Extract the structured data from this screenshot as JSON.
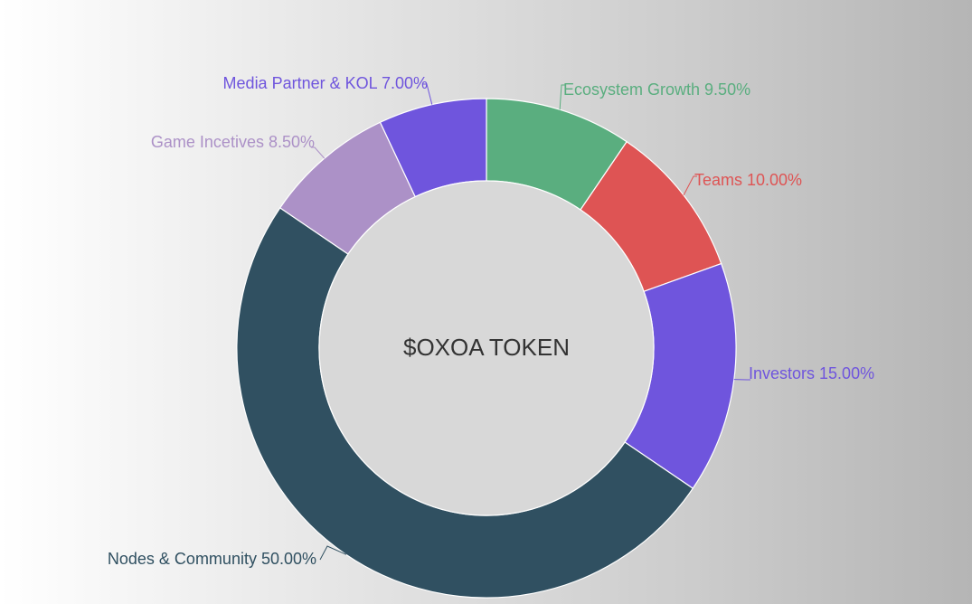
{
  "chart_data": {
    "type": "pie",
    "variant": "donut",
    "center_label": "$OXOA TOKEN",
    "legend": "none",
    "slices": [
      {
        "label": "Ecosystem Growth",
        "value_label": "9.50%",
        "value": 9.5,
        "color": "#5aae7f"
      },
      {
        "label": "Teams",
        "value_label": "10.00%",
        "value": 10.0,
        "color": "#de5454"
      },
      {
        "label": "Investors",
        "value_label": "15.00%",
        "value": 15.0,
        "color": "#6f55dd"
      },
      {
        "label": "Nodes & Community",
        "value_label": "50.00%",
        "value": 50.0,
        "color": "#305061"
      },
      {
        "label": "Game Incetives",
        "value_label": "8.50%",
        "value": 8.5,
        "color": "#ac91c7"
      },
      {
        "label": "Media Partner & KOL",
        "value_label": "7.00%",
        "value": 7.0,
        "color": "#6f55dd"
      }
    ],
    "center_fill": "#d8d8d8",
    "center_text_color": "#333333"
  }
}
